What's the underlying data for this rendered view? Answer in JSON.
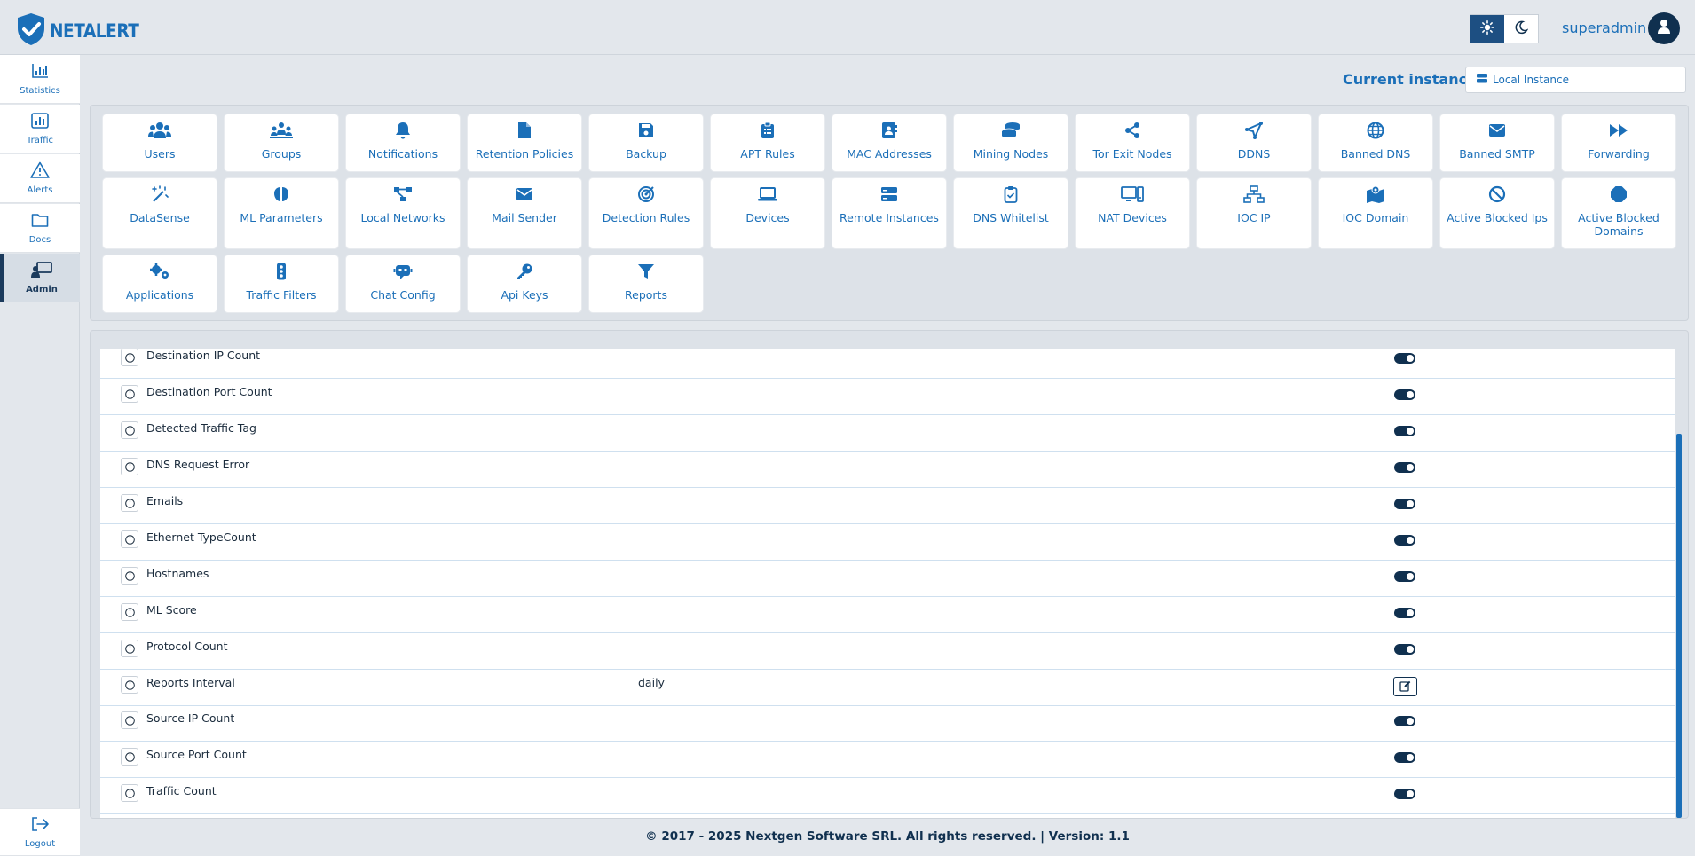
{
  "header": {
    "logo_text": "NETALERT",
    "user_name": "superadmin",
    "theme": {
      "light_icon": "sun-icon",
      "dark_icon": "moon-icon",
      "active": "light"
    }
  },
  "colors": {
    "accent": "#1b6fb8",
    "dark": "#10304f",
    "background": "#e3e7ec"
  },
  "sidebar": {
    "items": [
      {
        "label": "Statistics",
        "icon": "bar-chart-icon"
      },
      {
        "label": "Traffic",
        "icon": "traffic-chart-icon"
      },
      {
        "label": "Alerts",
        "icon": "warning-icon"
      },
      {
        "label": "Docs",
        "icon": "folder-icon"
      },
      {
        "label": "Admin",
        "icon": "admin-presentation-icon",
        "active": true
      }
    ],
    "logout_label": "Logout"
  },
  "instance": {
    "label": "Current instance:",
    "value": "Local Instance"
  },
  "tiles": [
    {
      "label": "Users",
      "icon": "users-icon"
    },
    {
      "label": "Groups",
      "icon": "groups-icon"
    },
    {
      "label": "Notifications",
      "icon": "bell-icon"
    },
    {
      "label": "Retention Policies",
      "icon": "file-icon"
    },
    {
      "label": "Backup",
      "icon": "floppy-icon"
    },
    {
      "label": "APT Rules",
      "icon": "clipboard-list-icon"
    },
    {
      "label": "MAC Addresses",
      "icon": "address-book-icon"
    },
    {
      "label": "Mining Nodes",
      "icon": "coins-icon"
    },
    {
      "label": "Tor Exit Nodes",
      "icon": "share-nodes-icon"
    },
    {
      "label": "DDNS",
      "icon": "location-arrow-icon"
    },
    {
      "label": "Banned DNS",
      "icon": "globe-icon"
    },
    {
      "label": "Banned SMTP",
      "icon": "envelope-icon"
    },
    {
      "label": "Forwarding",
      "icon": "forward-icon"
    },
    {
      "label": "DataSense",
      "icon": "magic-wand-icon"
    },
    {
      "label": "ML Parameters",
      "icon": "brain-icon"
    },
    {
      "label": "Local Networks",
      "icon": "diagram-icon"
    },
    {
      "label": "Mail Sender",
      "icon": "envelope-icon"
    },
    {
      "label": "Detection Rules",
      "icon": "bullseye-icon"
    },
    {
      "label": "Devices",
      "icon": "laptop-icon"
    },
    {
      "label": "Remote Instances",
      "icon": "server-icon"
    },
    {
      "label": "DNS Whitelist",
      "icon": "clipboard-check-icon"
    },
    {
      "label": "NAT Devices",
      "icon": "computer-icon"
    },
    {
      "label": "IOC IP",
      "icon": "network-wired-icon"
    },
    {
      "label": "IOC Domain",
      "icon": "map-location-icon"
    },
    {
      "label": "Active Blocked Ips",
      "icon": "ban-icon"
    },
    {
      "label": "Active Blocked Domains",
      "icon": "stop-octagon-icon"
    },
    {
      "label": "Applications",
      "icon": "gears-icon"
    },
    {
      "label": "Traffic Filters",
      "icon": "traffic-light-icon"
    },
    {
      "label": "Chat Config",
      "icon": "robot-icon"
    },
    {
      "label": "Api Keys",
      "icon": "key-icon"
    },
    {
      "label": "Reports",
      "icon": "filter-icon"
    }
  ],
  "settings": [
    {
      "name": "Destination IP Count",
      "value": "",
      "control": "toggle",
      "enabled": true
    },
    {
      "name": "Destination Port Count",
      "value": "",
      "control": "toggle",
      "enabled": true
    },
    {
      "name": "Detected Traffic Tag",
      "value": "",
      "control": "toggle",
      "enabled": true
    },
    {
      "name": "DNS Request Error",
      "value": "",
      "control": "toggle",
      "enabled": true
    },
    {
      "name": "Emails",
      "value": "",
      "control": "toggle",
      "enabled": true
    },
    {
      "name": "Ethernet TypeCount",
      "value": "",
      "control": "toggle",
      "enabled": true
    },
    {
      "name": "Hostnames",
      "value": "",
      "control": "toggle",
      "enabled": true
    },
    {
      "name": "ML Score",
      "value": "",
      "control": "toggle",
      "enabled": true
    },
    {
      "name": "Protocol Count",
      "value": "",
      "control": "toggle",
      "enabled": true
    },
    {
      "name": "Reports Interval",
      "value": "daily",
      "control": "edit"
    },
    {
      "name": "Source IP Count",
      "value": "",
      "control": "toggle",
      "enabled": true
    },
    {
      "name": "Source Port Count",
      "value": "",
      "control": "toggle",
      "enabled": true
    },
    {
      "name": "Traffic Count",
      "value": "",
      "control": "toggle",
      "enabled": true
    }
  ],
  "footer": {
    "text": "© 2017 - 2025 Nextgen Software SRL. All rights reserved. | Version: 1.1"
  }
}
